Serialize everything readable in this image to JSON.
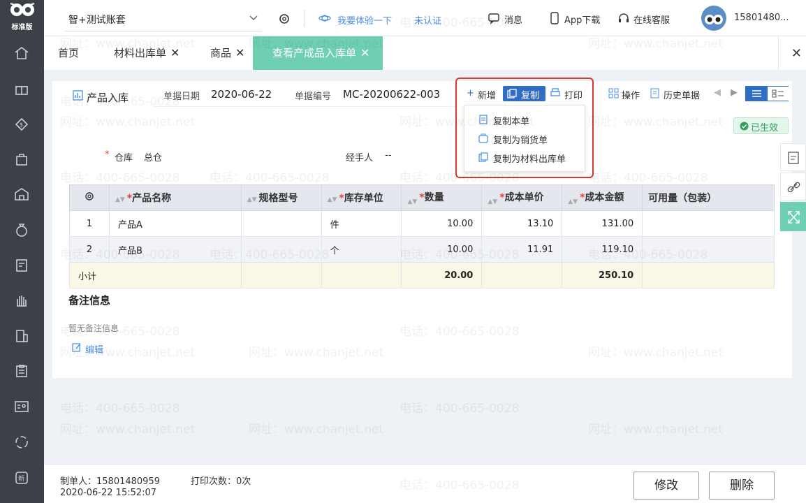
{
  "sidebar": {
    "edition": "标准版",
    "items": [
      "home-icon",
      "gift-icon",
      "money-bag-icon",
      "shopping-bag-icon",
      "warehouse-icon",
      "yen-bag-icon",
      "invoice-icon",
      "hand-icon",
      "building-icon",
      "clipboard-icon",
      "id-card-icon",
      "cycle-icon",
      "new-badge-icon"
    ]
  },
  "topbar": {
    "account": "智+测试账套",
    "try_label": "我要体验一下",
    "auth_label": "未认证",
    "messages": "消息",
    "app_download": "App下载",
    "support": "在线客服",
    "user": "15801480..."
  },
  "tabs": [
    {
      "label": "首页"
    },
    {
      "label": "材料出库单"
    },
    {
      "label": "商品"
    },
    {
      "label": "查看产成品入库单"
    }
  ],
  "doc": {
    "type_tab": "产品入库",
    "date_label": "单据日期",
    "date": "2020-06-22",
    "no_label": "单据编号",
    "no": "MC-20200622-003",
    "warehouse_label": "仓库",
    "warehouse": "总仓",
    "handler_label": "经手人",
    "handler": "--",
    "status": "已生效"
  },
  "toolbar": {
    "new": "新增",
    "copy": "复制",
    "print": "打印",
    "ops": "操作",
    "history": "历史单据"
  },
  "copy_menu": [
    "复制本单",
    "复制为销货单",
    "复制为材料出库单"
  ],
  "table": {
    "headers": [
      "产品名称",
      "规格型号",
      "库存单位",
      "数量",
      "成本单价",
      "成本金额",
      "可用量（包装）"
    ],
    "rows": [
      {
        "idx": "1",
        "name": "产品A",
        "spec": "",
        "unit": "件",
        "qty": "10.00",
        "price": "13.10",
        "amount": "131.00",
        "avail": ""
      },
      {
        "idx": "2",
        "name": "产品B",
        "spec": "",
        "unit": "个",
        "qty": "10.00",
        "price": "11.91",
        "amount": "119.10",
        "avail": ""
      }
    ],
    "subtotal": {
      "label": "小计",
      "qty": "20.00",
      "amount": "250.10"
    }
  },
  "notes": {
    "title": "备注信息",
    "empty": "暂无备注信息",
    "edit": "编辑"
  },
  "footer": {
    "creator": "制单人：15801480959",
    "created_at": "2020-06-22 15:52:07",
    "print_count": "打印次数：0次",
    "modify": "修改",
    "delete": "删除"
  },
  "watermark": {
    "phone": "电话：400-665-0028",
    "site": "网址：www.chanjet.net"
  },
  "colors": {
    "sidebar": "#3c4047",
    "accent": "#6fcfb3",
    "primary": "#2f6ec4",
    "highlight": "#d9382c"
  }
}
